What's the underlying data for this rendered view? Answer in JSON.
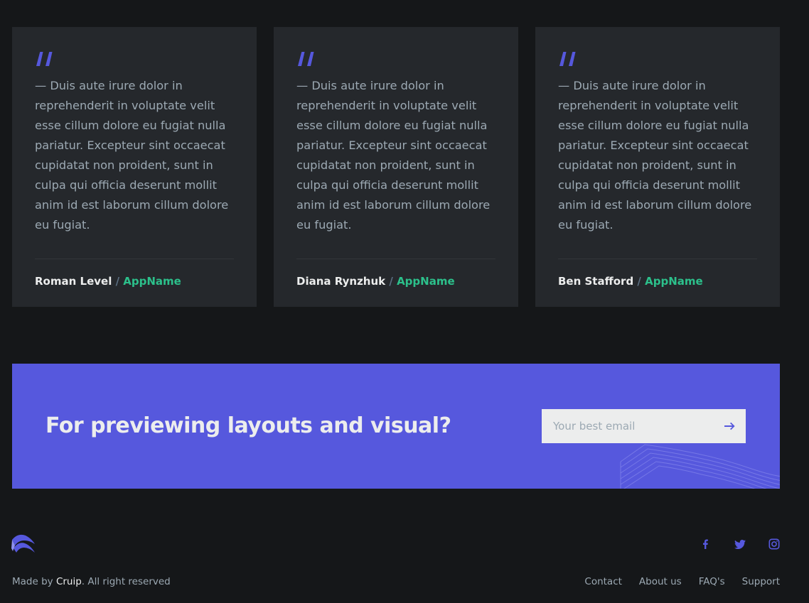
{
  "testimonials": [
    {
      "quote": "— Duis aute irure dolor in reprehenderit in voluptate velit esse cillum dolore eu fugiat nulla pariatur. Excepteur sint occaecat cupidatat non proident, sunt in culpa qui officia deserunt mollit anim id est laborum cillum dolore eu fugiat.",
      "author": "Roman Level",
      "separator": " / ",
      "app": "AppName"
    },
    {
      "quote": "— Duis aute irure dolor in reprehenderit in voluptate velit esse cillum dolore eu fugiat nulla pariatur. Excepteur sint occaecat cupidatat non proident, sunt in culpa qui officia deserunt mollit anim id est laborum cillum dolore eu fugiat.",
      "author": "Diana Rynzhuk",
      "separator": " / ",
      "app": "AppName"
    },
    {
      "quote": "— Duis aute irure dolor in reprehenderit in voluptate velit esse cillum dolore eu fugiat nulla pariatur. Excepteur sint occaecat cupidatat non proident, sunt in culpa qui officia deserunt mollit anim id est laborum cillum dolore eu fugiat.",
      "author": "Ben Stafford",
      "separator": " / ",
      "app": "AppName"
    }
  ],
  "cta": {
    "title": "For previewing layouts and visual?",
    "email_placeholder": "Your best email",
    "submit_icon": "arrow-right-icon"
  },
  "footer": {
    "logo_icon": "brand-logo-icon",
    "social_icons": [
      "facebook-icon",
      "twitter-icon",
      "instagram-icon"
    ],
    "copyright_prefix": "Made by ",
    "copyright_brand": "Cruip",
    "copyright_suffix": ". All right reserved",
    "nav": [
      "Contact",
      "About us",
      "FAQ's",
      "Support"
    ]
  },
  "colors": {
    "background": "#151719",
    "card": "#25282c",
    "accent": "#5658dd",
    "link_green": "#2cc08b",
    "text_light": "#eceded",
    "text_muted": "#9ca9b3"
  }
}
